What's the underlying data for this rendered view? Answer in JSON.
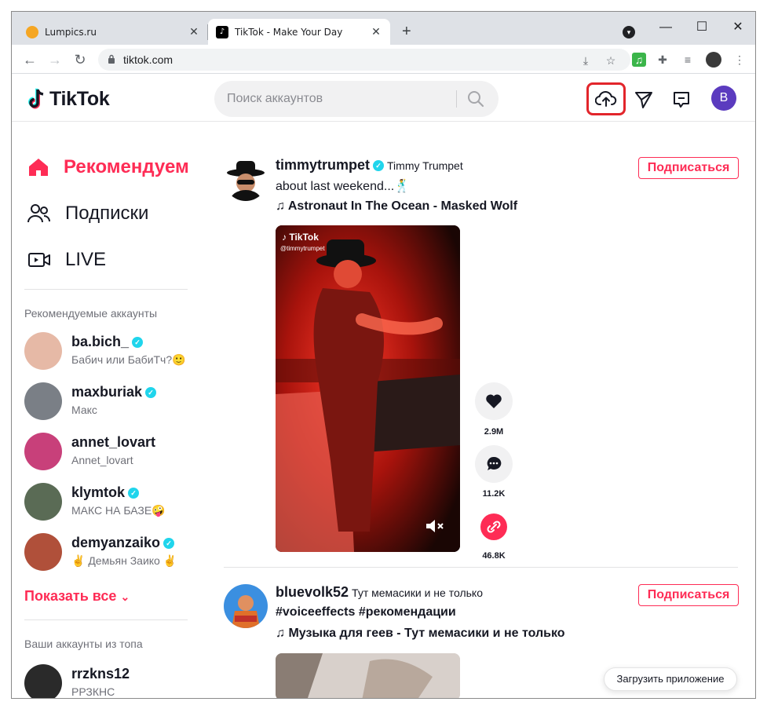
{
  "browser": {
    "tabs": [
      {
        "title": "Lumpics.ru",
        "active": false,
        "favicon": "lumpics-favicon"
      },
      {
        "title": "TikTok - Make Your Day",
        "active": true,
        "favicon": "tiktok-favicon"
      }
    ],
    "new_tab": "+",
    "window_controls": {
      "minimize": "—",
      "maximize": "☐",
      "close": "✕"
    },
    "url": "tiktok.com"
  },
  "header": {
    "logo_text": "TikTok",
    "search_placeholder": "Поиск аккаунтов",
    "avatar_letter": "B",
    "accent_color": "#fe2c55",
    "highlight_color": "#e2252b"
  },
  "sidebar": {
    "nav": [
      {
        "label": "Рекомендуем",
        "icon": "home-icon",
        "active": true
      },
      {
        "label": "Подписки",
        "icon": "users-icon",
        "active": false
      },
      {
        "label": "LIVE",
        "icon": "live-icon",
        "active": false
      }
    ],
    "suggested_title": "Рекомендуемые аккаунты",
    "suggested": [
      {
        "username": "ba.bich_",
        "nickname": "Бабич или БабиТч?🙂",
        "verified": true,
        "color": "#e6b9a6"
      },
      {
        "username": "maxburiak",
        "nickname": "Макс",
        "verified": true,
        "color": "#7a7f86"
      },
      {
        "username": "annet_lovart",
        "nickname": "Annet_lovart",
        "verified": false,
        "color": "#c8407a"
      },
      {
        "username": "klymtok",
        "nickname": "МАКС НА БАЗЕ🤪",
        "verified": true,
        "color": "#5a6b55"
      },
      {
        "username": "demyanzaiko",
        "nickname": "✌️ Демьян Заико ✌️",
        "verified": true,
        "color": "#b0503a"
      }
    ],
    "show_all": "Показать все",
    "top_title": "Ваши аккаунты из топа",
    "top": [
      {
        "username": "rrzkns12",
        "nickname": "РРЗКНС",
        "color": "#2a2a2a"
      }
    ]
  },
  "feed": [
    {
      "username": "timmytrumpet",
      "nickname": "Timmy Trumpet",
      "verified": true,
      "description": "about last weekend...🕺",
      "music": "Astronaut In The Ocean - Masked Wolf",
      "follow_label": "Подписаться",
      "video_watermark": "TikTok",
      "video_handle": "@timmytrumpet",
      "likes": "2.9M",
      "comments": "11.2K",
      "shares": "46.8K"
    },
    {
      "username": "bluevolk52",
      "nickname": "Тут мемасики и не только",
      "verified": false,
      "description": "#voiceeffects #рекомендации",
      "music": "Музыка для геев - Тут мемасики и не только",
      "follow_label": "Подписаться"
    }
  ],
  "get_app": "Загрузить приложение"
}
